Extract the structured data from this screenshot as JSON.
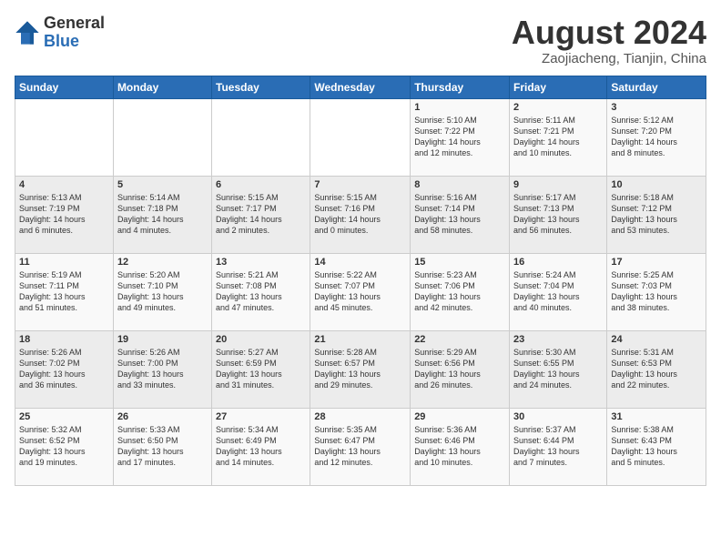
{
  "header": {
    "logo_line1": "General",
    "logo_line2": "Blue",
    "month": "August 2024",
    "location": "Zaojiacheng, Tianjin, China"
  },
  "weekdays": [
    "Sunday",
    "Monday",
    "Tuesday",
    "Wednesday",
    "Thursday",
    "Friday",
    "Saturday"
  ],
  "weeks": [
    [
      {
        "day": "",
        "info": ""
      },
      {
        "day": "",
        "info": ""
      },
      {
        "day": "",
        "info": ""
      },
      {
        "day": "",
        "info": ""
      },
      {
        "day": "1",
        "info": "Sunrise: 5:10 AM\nSunset: 7:22 PM\nDaylight: 14 hours\nand 12 minutes."
      },
      {
        "day": "2",
        "info": "Sunrise: 5:11 AM\nSunset: 7:21 PM\nDaylight: 14 hours\nand 10 minutes."
      },
      {
        "day": "3",
        "info": "Sunrise: 5:12 AM\nSunset: 7:20 PM\nDaylight: 14 hours\nand 8 minutes."
      }
    ],
    [
      {
        "day": "4",
        "info": "Sunrise: 5:13 AM\nSunset: 7:19 PM\nDaylight: 14 hours\nand 6 minutes."
      },
      {
        "day": "5",
        "info": "Sunrise: 5:14 AM\nSunset: 7:18 PM\nDaylight: 14 hours\nand 4 minutes."
      },
      {
        "day": "6",
        "info": "Sunrise: 5:15 AM\nSunset: 7:17 PM\nDaylight: 14 hours\nand 2 minutes."
      },
      {
        "day": "7",
        "info": "Sunrise: 5:15 AM\nSunset: 7:16 PM\nDaylight: 14 hours\nand 0 minutes."
      },
      {
        "day": "8",
        "info": "Sunrise: 5:16 AM\nSunset: 7:14 PM\nDaylight: 13 hours\nand 58 minutes."
      },
      {
        "day": "9",
        "info": "Sunrise: 5:17 AM\nSunset: 7:13 PM\nDaylight: 13 hours\nand 56 minutes."
      },
      {
        "day": "10",
        "info": "Sunrise: 5:18 AM\nSunset: 7:12 PM\nDaylight: 13 hours\nand 53 minutes."
      }
    ],
    [
      {
        "day": "11",
        "info": "Sunrise: 5:19 AM\nSunset: 7:11 PM\nDaylight: 13 hours\nand 51 minutes."
      },
      {
        "day": "12",
        "info": "Sunrise: 5:20 AM\nSunset: 7:10 PM\nDaylight: 13 hours\nand 49 minutes."
      },
      {
        "day": "13",
        "info": "Sunrise: 5:21 AM\nSunset: 7:08 PM\nDaylight: 13 hours\nand 47 minutes."
      },
      {
        "day": "14",
        "info": "Sunrise: 5:22 AM\nSunset: 7:07 PM\nDaylight: 13 hours\nand 45 minutes."
      },
      {
        "day": "15",
        "info": "Sunrise: 5:23 AM\nSunset: 7:06 PM\nDaylight: 13 hours\nand 42 minutes."
      },
      {
        "day": "16",
        "info": "Sunrise: 5:24 AM\nSunset: 7:04 PM\nDaylight: 13 hours\nand 40 minutes."
      },
      {
        "day": "17",
        "info": "Sunrise: 5:25 AM\nSunset: 7:03 PM\nDaylight: 13 hours\nand 38 minutes."
      }
    ],
    [
      {
        "day": "18",
        "info": "Sunrise: 5:26 AM\nSunset: 7:02 PM\nDaylight: 13 hours\nand 36 minutes."
      },
      {
        "day": "19",
        "info": "Sunrise: 5:26 AM\nSunset: 7:00 PM\nDaylight: 13 hours\nand 33 minutes."
      },
      {
        "day": "20",
        "info": "Sunrise: 5:27 AM\nSunset: 6:59 PM\nDaylight: 13 hours\nand 31 minutes."
      },
      {
        "day": "21",
        "info": "Sunrise: 5:28 AM\nSunset: 6:57 PM\nDaylight: 13 hours\nand 29 minutes."
      },
      {
        "day": "22",
        "info": "Sunrise: 5:29 AM\nSunset: 6:56 PM\nDaylight: 13 hours\nand 26 minutes."
      },
      {
        "day": "23",
        "info": "Sunrise: 5:30 AM\nSunset: 6:55 PM\nDaylight: 13 hours\nand 24 minutes."
      },
      {
        "day": "24",
        "info": "Sunrise: 5:31 AM\nSunset: 6:53 PM\nDaylight: 13 hours\nand 22 minutes."
      }
    ],
    [
      {
        "day": "25",
        "info": "Sunrise: 5:32 AM\nSunset: 6:52 PM\nDaylight: 13 hours\nand 19 minutes."
      },
      {
        "day": "26",
        "info": "Sunrise: 5:33 AM\nSunset: 6:50 PM\nDaylight: 13 hours\nand 17 minutes."
      },
      {
        "day": "27",
        "info": "Sunrise: 5:34 AM\nSunset: 6:49 PM\nDaylight: 13 hours\nand 14 minutes."
      },
      {
        "day": "28",
        "info": "Sunrise: 5:35 AM\nSunset: 6:47 PM\nDaylight: 13 hours\nand 12 minutes."
      },
      {
        "day": "29",
        "info": "Sunrise: 5:36 AM\nSunset: 6:46 PM\nDaylight: 13 hours\nand 10 minutes."
      },
      {
        "day": "30",
        "info": "Sunrise: 5:37 AM\nSunset: 6:44 PM\nDaylight: 13 hours\nand 7 minutes."
      },
      {
        "day": "31",
        "info": "Sunrise: 5:38 AM\nSunset: 6:43 PM\nDaylight: 13 hours\nand 5 minutes."
      }
    ]
  ]
}
